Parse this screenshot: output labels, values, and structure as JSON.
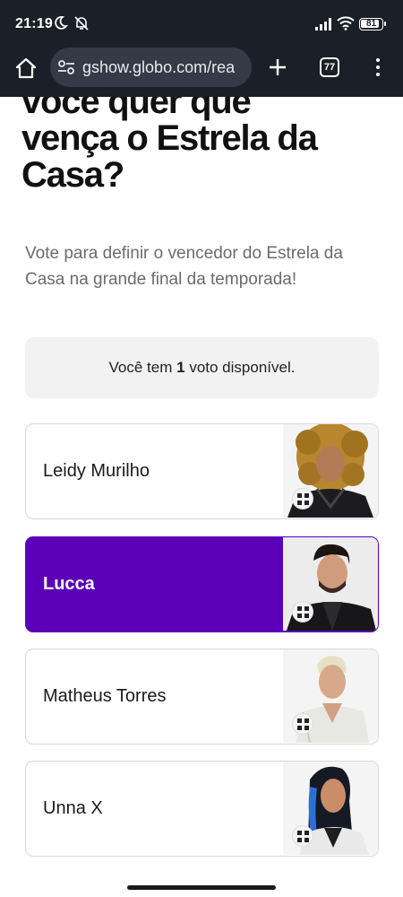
{
  "status_bar": {
    "time": "21:19",
    "battery_level": "81"
  },
  "browser": {
    "url": "gshow.globo.com/rea",
    "tab_count": "77",
    "icons": [
      "home-icon",
      "site-settings-icon",
      "new-tab-icon",
      "tab-switcher-icon",
      "more-menu-icon"
    ]
  },
  "page": {
    "headline_lines": [
      "você quer que",
      "vença o Estrela da",
      "Casa?"
    ],
    "subtitle": "Vote para definir o vencedor do Estrela da Casa na grande final da temporada!",
    "votes": {
      "prefix": "Você tem",
      "count": "1",
      "suffix": "voto disponível."
    },
    "candidates": [
      {
        "name": "Leidy Murilho",
        "selected": false
      },
      {
        "name": "Lucca",
        "selected": true
      },
      {
        "name": "Matheus Torres",
        "selected": false
      },
      {
        "name": "Unna X",
        "selected": false
      }
    ]
  },
  "colors": {
    "selected_card": "#5b00b8",
    "browser_chrome": "#1b1f27"
  }
}
